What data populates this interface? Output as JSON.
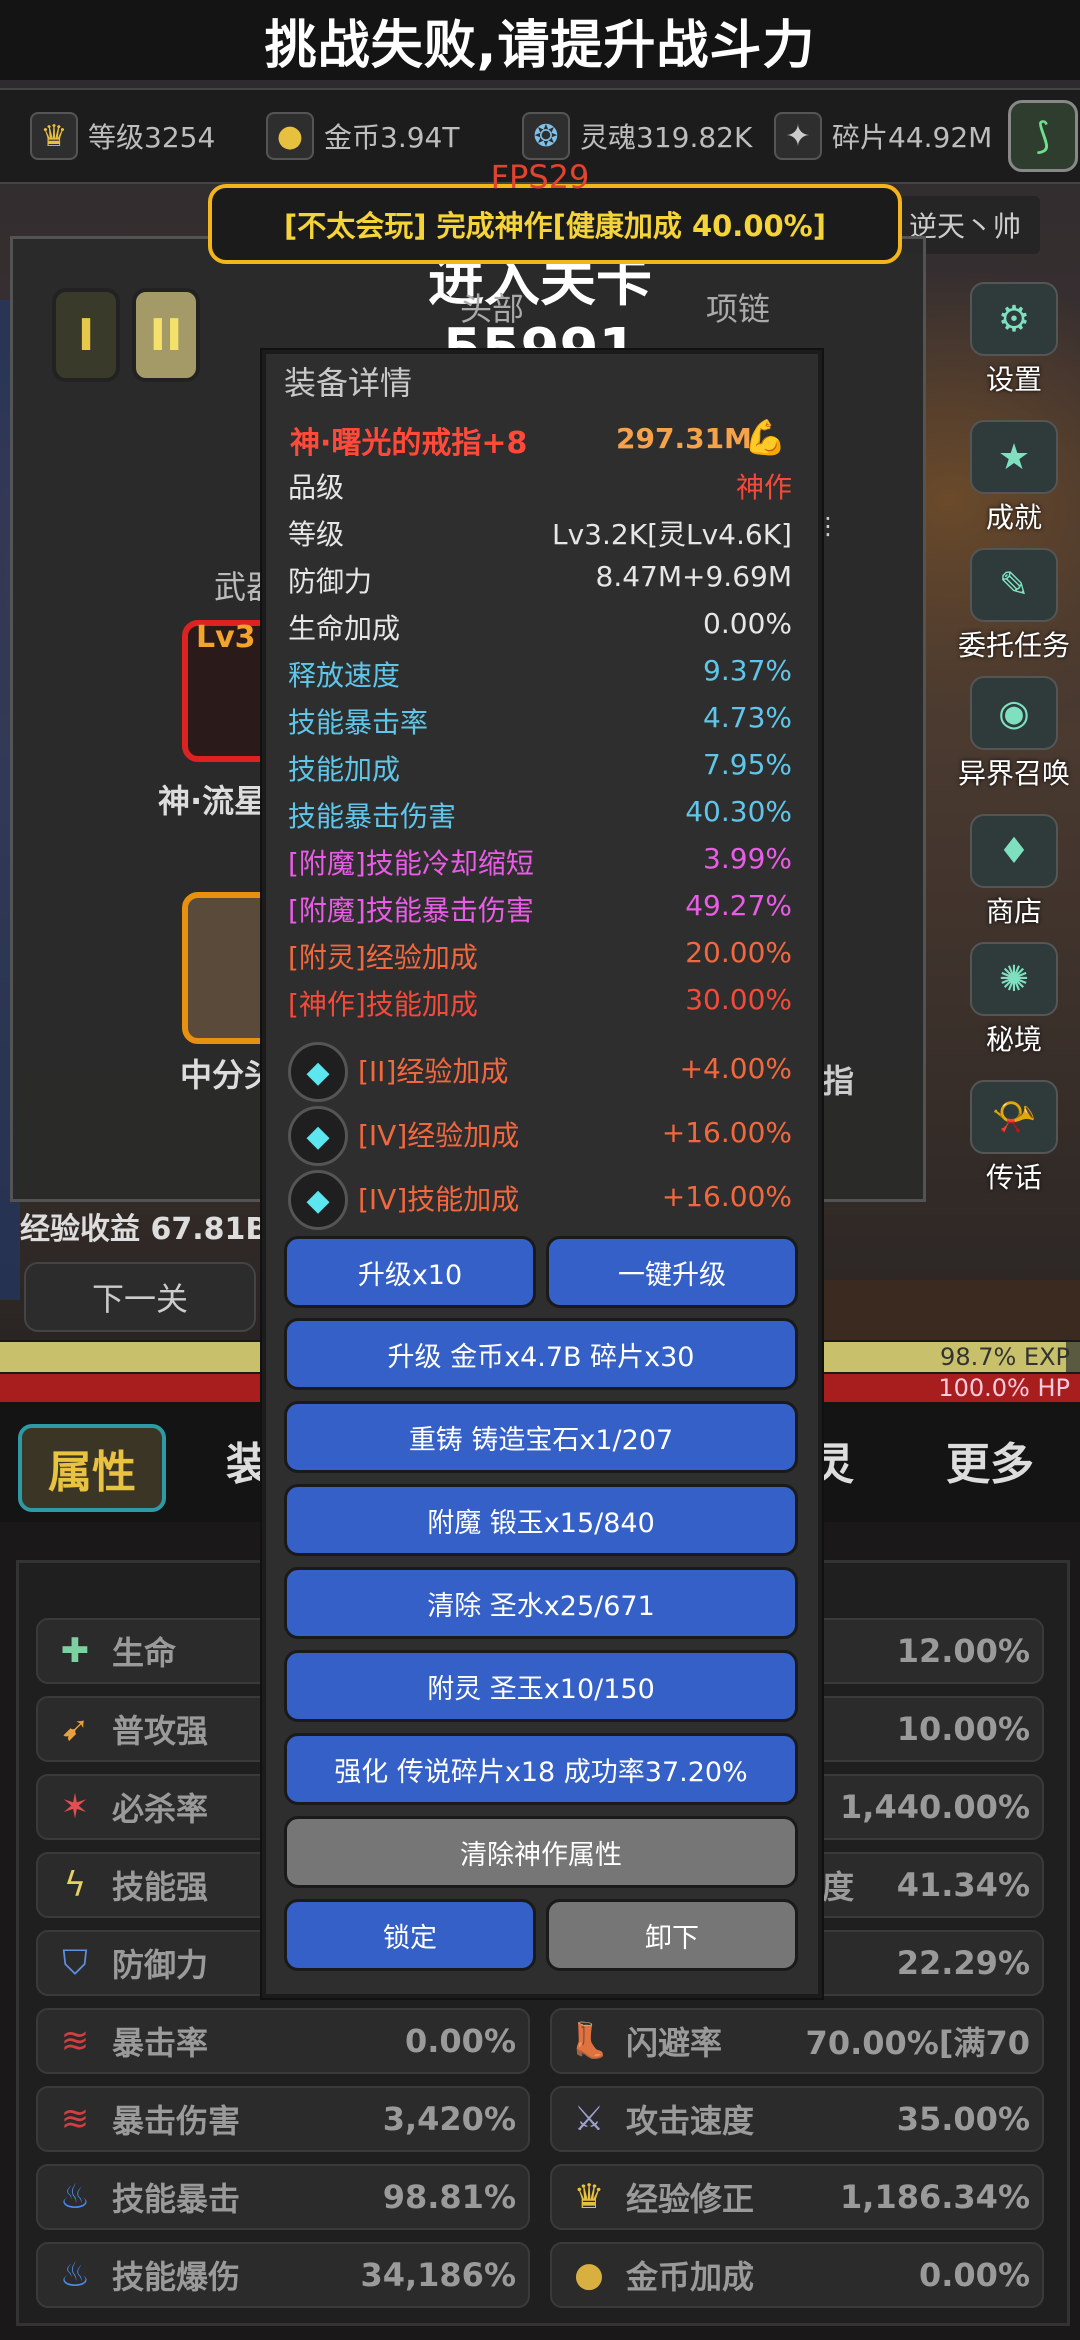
{
  "top_banner": "挑战失败,请提升战斗力",
  "resources": {
    "level": "等级3254",
    "gold": "金币3.94T",
    "soul": "灵魂319.82K",
    "fragment": "碎片44.92M"
  },
  "fps": "FPS29",
  "notice": "[不太会玩] 完成神作[健康加成 40.00%]",
  "player_name": "逆天丶帅",
  "background": {
    "stage_title": "进入关卡55991",
    "tier_1": "I",
    "tier_2": "II",
    "slot_head": "头部",
    "slot_neck": "项链",
    "weapon_label": "武器",
    "lv_tag": "Lv3",
    "item_1_name": "神·流星",
    "item_2_name": "中分头",
    "right_frag": "指",
    "exp_income": "经验收益 67.81B/",
    "next_stage": "下一关",
    "exp_pct": "98.7% EXP",
    "exp_fill": 0.987,
    "hp_pct": "100.0%  HP"
  },
  "right_menu": [
    {
      "label": "设置",
      "icon": "gear-icon",
      "glyph": "⚙"
    },
    {
      "label": "成就",
      "icon": "star-icon",
      "glyph": "★"
    },
    {
      "label": "委托任务",
      "icon": "scroll-icon",
      "glyph": "✎"
    },
    {
      "label": "异界召唤",
      "icon": "eye-icon",
      "glyph": "◉"
    },
    {
      "label": "商店",
      "icon": "bag-icon",
      "glyph": "♦"
    },
    {
      "label": "秘境",
      "icon": "portal-icon",
      "glyph": "✺"
    },
    {
      "label": "传话",
      "icon": "horn-icon",
      "glyph": "📯"
    }
  ],
  "bottom_tabs": {
    "attr": "属性",
    "equip": "装",
    "soul": "灵",
    "more": "更多"
  },
  "stats_left": [
    {
      "label": "生命",
      "value": "",
      "icon": "health-icon",
      "glyph": "✚",
      "color": "#7fd0a0"
    },
    {
      "label": "普攻强",
      "value": "",
      "icon": "attack-icon",
      "glyph": "➹",
      "color": "#e8a040"
    },
    {
      "label": "必杀率",
      "value": "",
      "icon": "crit-icon",
      "glyph": "✶",
      "color": "#e05050"
    },
    {
      "label": "技能强",
      "value": "",
      "icon": "lightning-icon",
      "glyph": "ϟ",
      "color": "#e8d060"
    },
    {
      "label": "防御力",
      "value": "",
      "icon": "shield-icon",
      "glyph": "⛉",
      "color": "#6090e0"
    },
    {
      "label": "暴击率",
      "value": "0.00%",
      "icon": "claw-icon",
      "glyph": "≋",
      "color": "#d04040"
    },
    {
      "label": "暴击伤害",
      "value": "3,420%",
      "icon": "claw-red-icon",
      "glyph": "≋",
      "color": "#d04040"
    },
    {
      "label": "技能暴击",
      "value": "98.81%",
      "icon": "blue-flame-icon",
      "glyph": "♨",
      "color": "#4a8ae8"
    },
    {
      "label": "技能爆伤",
      "value": "34,186%",
      "icon": "blue-fire-icon",
      "glyph": "♨",
      "color": "#4a8ae8"
    }
  ],
  "stats_right": [
    {
      "label": "",
      "value": "12.00%",
      "icon": "",
      "glyph": "",
      "color": "#888"
    },
    {
      "label": "",
      "value": "10.00%",
      "icon": "",
      "glyph": "",
      "color": "#888"
    },
    {
      "label": "",
      "value": "1,440.00%",
      "icon": "",
      "glyph": "",
      "color": "#888"
    },
    {
      "label": "度",
      "value": "41.34%",
      "icon": "",
      "glyph": "",
      "color": "#888"
    },
    {
      "label": "",
      "value": "22.29%",
      "icon": "",
      "glyph": "",
      "color": "#888"
    },
    {
      "label": "闪避率",
      "value": "70.00%[满70",
      "icon": "boot-icon",
      "glyph": "👢",
      "color": "#e8d080"
    },
    {
      "label": "攻击速度",
      "value": "35.00%",
      "icon": "swords-icon",
      "glyph": "⚔",
      "color": "#a0a0d0"
    },
    {
      "label": "经验修正",
      "value": "1,186.34%",
      "icon": "crown-icon",
      "glyph": "♛",
      "color": "#e8c040"
    },
    {
      "label": "金币加成",
      "value": "0.00%",
      "icon": "coin-icon",
      "glyph": "●",
      "color": "#d8b040"
    }
  ],
  "popup": {
    "title": "装备详情",
    "item_name": "神·曙光的戒指+8",
    "power": "297.31M",
    "rows": [
      {
        "label": "品级",
        "value": "神作",
        "lc": "c-white",
        "vc": "c-red"
      },
      {
        "label": "等级",
        "value": "Lv3.2K[灵Lv4.6K]",
        "lc": "c-white",
        "vc": "c-white"
      },
      {
        "label": "防御力",
        "value": "8.47M+9.69M",
        "lc": "c-white",
        "vc": "c-white"
      },
      {
        "label": "生命加成",
        "value": "0.00%",
        "lc": "c-white",
        "vc": "c-white"
      },
      {
        "label": "释放速度",
        "value": "9.37%",
        "lc": "c-blue",
        "vc": "c-blue"
      },
      {
        "label": "技能暴击率",
        "value": "4.73%",
        "lc": "c-blue",
        "vc": "c-blue"
      },
      {
        "label": "技能加成",
        "value": "7.95%",
        "lc": "c-blue",
        "vc": "c-blue"
      },
      {
        "label": "技能暴击伤害",
        "value": "40.30%",
        "lc": "c-blue",
        "vc": "c-blue"
      },
      {
        "label": "[附魔]技能冷却缩短",
        "value": "3.99%",
        "lc": "c-pink",
        "vc": "c-pink"
      },
      {
        "label": "[附魔]技能暴击伤害",
        "value": "49.27%",
        "lc": "c-pink",
        "vc": "c-pink"
      },
      {
        "label": "[附灵]经验加成",
        "value": "20.00%",
        "lc": "c-orange",
        "vc": "c-orange"
      },
      {
        "label": "[神作]技能加成",
        "value": "30.00%",
        "lc": "c-red",
        "vc": "c-red"
      }
    ],
    "gems": [
      {
        "label": "[II]经验加成",
        "value": "+4.00%"
      },
      {
        "label": "[IV]经验加成",
        "value": "+16.00%"
      },
      {
        "label": "[IV]技能加成",
        "value": "+16.00%"
      }
    ],
    "buttons": {
      "upgrade_x10": "升级x10",
      "one_key": "一键升级",
      "upgrade": "升级 金币x4.7B 碎片x30",
      "reforge": "重铸 铸造宝石x1/207",
      "enchant": "附魔 锻玉x15/840",
      "clear": "清除 圣水x25/671",
      "spirit": "附灵 圣玉x10/150",
      "strengthen": "强化 传说碎片x18 成功率37.20%",
      "clear_masterwork": "清除神作属性",
      "lock": "锁定",
      "unequip": "卸下"
    }
  }
}
